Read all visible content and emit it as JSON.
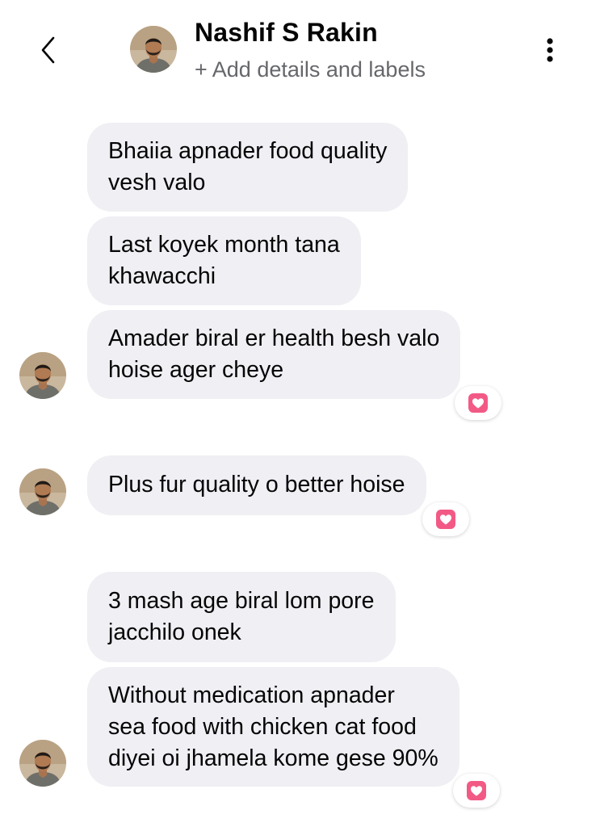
{
  "header": {
    "contact_name": "Nashif S Rakin",
    "subtitle": "+ Add details and labels"
  },
  "messages": [
    {
      "lines": [
        "Bhaiia apnader food quality",
        "vesh valo"
      ]
    },
    {
      "lines": [
        "Last koyek month tana",
        "khawacchi"
      ]
    },
    {
      "lines": [
        "Amader biral er health besh valo",
        "hoise ager cheye"
      ],
      "reaction": "heart"
    },
    {
      "lines": [
        "Plus fur quality o better hoise"
      ],
      "reaction": "heart"
    },
    {
      "lines": [
        "3 mash age biral lom pore",
        "jacchilo onek"
      ]
    },
    {
      "lines": [
        "Without medication apnader",
        "sea food with chicken cat food",
        "diyei oi jhamela kome gese 90%"
      ],
      "reaction": "heart"
    }
  ],
  "colors": {
    "bubble": "#efeff4",
    "reaction_heart": "#f25a85",
    "subtitle": "#65676b"
  },
  "icons": {
    "back": "chevron-left-icon",
    "menu": "more-vertical-icon",
    "reaction": "heart-icon"
  }
}
